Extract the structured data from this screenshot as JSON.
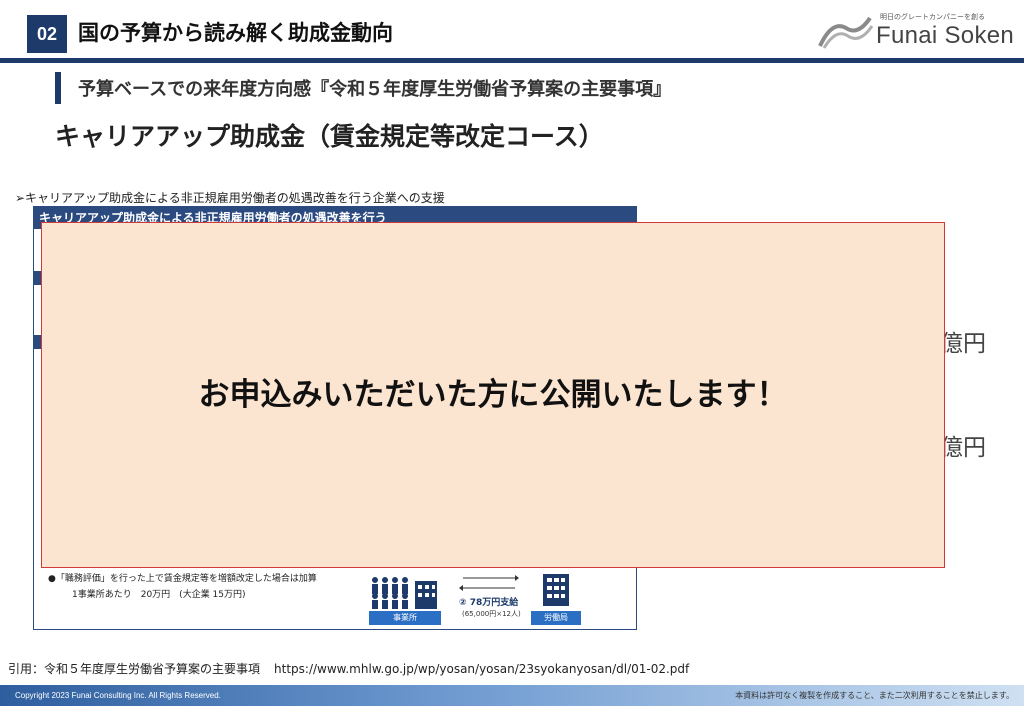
{
  "header": {
    "section_number": "02",
    "section_title": "国の予算から読み解く助成金動向",
    "logo_tagline": "明日のグレートカンパニーを創る",
    "logo_name": "Funai Soken"
  },
  "sub_heading": "予算ベースでの来年度方向感『令和５年度厚生労働省予算案の主要事項』",
  "main_heading": "キャリアアップ助成金（賃金規定等改定コース）",
  "bullet_line": "➢キャリアアップ助成金による非正規雇用労働者の処遇改善を行う企業への支援",
  "document": {
    "header_label": "キャリアアップ助成金による非正規雇用労働者の処遇改善を行う",
    "note1": "●「職務評価」を行った上で賃金規定等を増額改定した場合は加算",
    "note2": "1事業所あたり　20万円　(大企業 15万円)",
    "label_office": "事業所",
    "label_ministry": "労働局",
    "payment_amount": "② 78万円支給",
    "payment_detail": "(65,000円×12人)"
  },
  "side_text_1": "億円",
  "side_text_2": "億円",
  "overlay_message": "お申込みいただいた方に公開いたします！",
  "citation": {
    "label": "引用：令和５年度厚生労働省予算案の主要事項",
    "url": "https://www.mhlw.go.jp/wp/yosan/yosan/23syokanyosan/dl/01-02.pdf"
  },
  "footer": {
    "copyright": "Copyright 2023  Funai Consulting Inc.  All  Rights  Reserved.",
    "notice": "本資料は許可なく複製を作成すること、また二次利用することを禁止します。"
  },
  "colors": {
    "navy": "#1d3a6b",
    "overlay_fill": "#fbe5d0",
    "overlay_border": "#d23a3a"
  }
}
